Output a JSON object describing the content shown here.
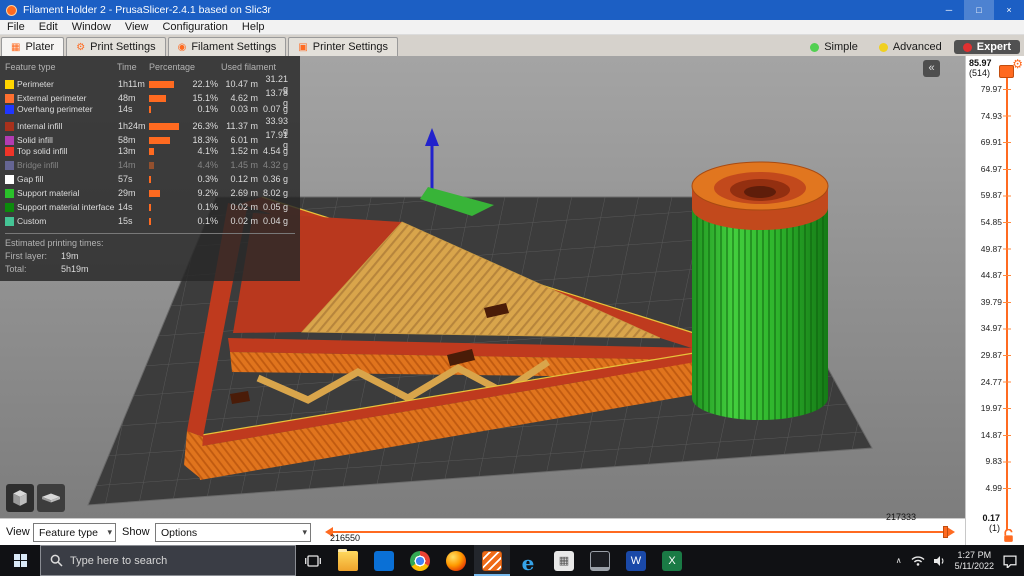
{
  "theme": {
    "accent": "#ff6a20"
  },
  "window": {
    "title": "Filament Holder 2 - PrusaSlicer-2.4.1 based on Slic3r",
    "minimize_glyph": "─",
    "maximize_glyph": "□",
    "close_glyph": "×"
  },
  "menubar": {
    "items": [
      "File",
      "Edit",
      "Window",
      "View",
      "Configuration",
      "Help"
    ]
  },
  "tabbar": {
    "tabs": [
      {
        "label": "Plater",
        "glyph": "▦",
        "active": true
      },
      {
        "label": "Print Settings",
        "glyph": "⚙",
        "active": false
      },
      {
        "label": "Filament Settings",
        "glyph": "◉",
        "active": false
      },
      {
        "label": "Printer Settings",
        "glyph": "▣",
        "active": false
      }
    ],
    "modes": [
      {
        "label": "Simple",
        "dot": "#52d052",
        "active": false
      },
      {
        "label": "Advanced",
        "dot": "#f0d020",
        "active": false
      },
      {
        "label": "Expert",
        "dot": "#e03030",
        "active": true
      }
    ]
  },
  "legend": {
    "headers": [
      "Feature type",
      "Time",
      "Percentage",
      "Used filament"
    ],
    "rows": [
      {
        "color": "#ffd500",
        "label": "Perimeter",
        "time": "1h11m",
        "pct": "22.1%",
        "pct_num": 22.1,
        "len": "10.47 m",
        "mass": "31.21 g",
        "dim": false
      },
      {
        "color": "#ff7030",
        "label": "External perimeter",
        "time": "48m",
        "pct": "15.1%",
        "pct_num": 15.1,
        "len": "4.62 m",
        "mass": "13.78 g",
        "dim": false
      },
      {
        "color": "#2036ff",
        "label": "Overhang perimeter",
        "time": "14s",
        "pct": "0.1%",
        "pct_num": 0.1,
        "len": "0.03 m",
        "mass": "0.07 g",
        "dim": false
      },
      {
        "color": "#a8311c",
        "label": "Internal infill",
        "time": "1h24m",
        "pct": "26.3%",
        "pct_num": 26.3,
        "len": "11.37 m",
        "mass": "33.93 g",
        "dim": false
      },
      {
        "color": "#b23cb2",
        "label": "Solid infill",
        "time": "58m",
        "pct": "18.3%",
        "pct_num": 18.3,
        "len": "6.01 m",
        "mass": "17.91 g",
        "dim": false
      },
      {
        "color": "#f03428",
        "label": "Top solid infill",
        "time": "13m",
        "pct": "4.1%",
        "pct_num": 4.1,
        "len": "1.52 m",
        "mass": "4.54 g",
        "dim": false
      },
      {
        "color": "#9999ff",
        "label": "Bridge infill",
        "time": "14m",
        "pct": "4.4%",
        "pct_num": 4.4,
        "len": "1.45 m",
        "mass": "4.32 g",
        "dim": true
      },
      {
        "color": "#ffffff",
        "label": "Gap fill",
        "time": "57s",
        "pct": "0.3%",
        "pct_num": 0.3,
        "len": "0.12 m",
        "mass": "0.36 g",
        "dim": false
      },
      {
        "color": "#2ac12a",
        "label": "Support material",
        "time": "29m",
        "pct": "9.2%",
        "pct_num": 9.2,
        "len": "2.69 m",
        "mass": "8.02 g",
        "dim": false
      },
      {
        "color": "#0c8a0c",
        "label": "Support material interface",
        "time": "14s",
        "pct": "0.1%",
        "pct_num": 0.1,
        "len": "0.02 m",
        "mass": "0.05 g",
        "dim": false
      },
      {
        "color": "#45c495",
        "label": "Custom",
        "time": "15s",
        "pct": "0.1%",
        "pct_num": 0.1,
        "len": "0.02 m",
        "mass": "0.04 g",
        "dim": false
      }
    ],
    "times": {
      "header": "Estimated printing times:",
      "first_label": "First layer:",
      "first_value": "19m",
      "total_label": "Total:",
      "total_value": "5h19m"
    }
  },
  "viewport": {
    "collapse_glyph": "«"
  },
  "layer_slider": {
    "max_value": "85.97",
    "max_layer": "(514)",
    "ticks": [
      "79.97",
      "74.93",
      "69.91",
      "64.97",
      "59.87",
      "54.85",
      "49.87",
      "44.87",
      "39.79",
      "34.97",
      "29.87",
      "24.77",
      "19.97",
      "14.87",
      "9.83",
      "4.99"
    ],
    "min_value": "0.17",
    "min_layer": "(1)",
    "gear_glyph": "⚙"
  },
  "move_slider": {
    "right_value": "217333",
    "left_value": "216550"
  },
  "view_bar": {
    "view_label": "View",
    "view_value": "Feature type",
    "show_label": "Show",
    "show_value": "Options"
  },
  "taskbar": {
    "search_placeholder": "Type here to search",
    "icons": [
      {
        "name": "file-explorer",
        "glyph": "",
        "active": false
      },
      {
        "name": "store",
        "glyph": "",
        "active": false
      },
      {
        "name": "chrome",
        "glyph": "",
        "active": false
      },
      {
        "name": "firefox",
        "glyph": "",
        "active": false
      },
      {
        "name": "prusaslicer",
        "glyph": "",
        "active": true
      },
      {
        "name": "edge",
        "glyph": "e",
        "active": false
      },
      {
        "name": "photos",
        "glyph": "▦",
        "active": false
      },
      {
        "name": "display",
        "glyph": "",
        "active": false
      },
      {
        "name": "word",
        "glyph": "W",
        "active": false
      },
      {
        "name": "excel",
        "glyph": "X",
        "active": false
      }
    ],
    "tray_chevron": "∧",
    "time": "1:27 PM",
    "date": "5/11/2022"
  }
}
